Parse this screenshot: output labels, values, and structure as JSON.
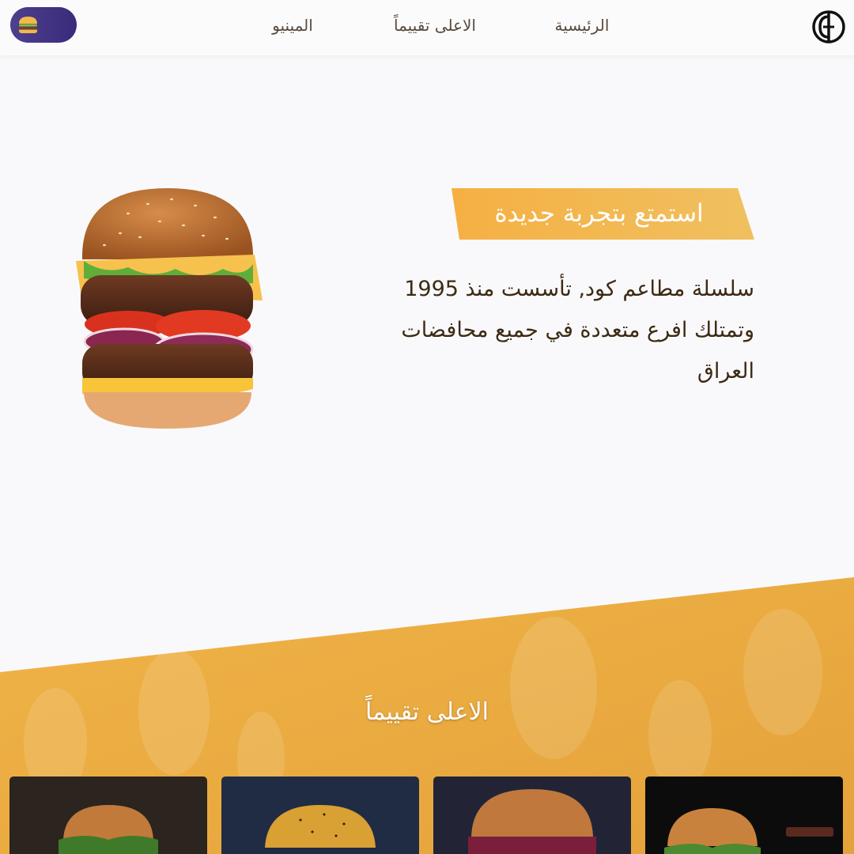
{
  "nav": {
    "links": [
      "الرئيسية",
      "الاعلى تقييماً",
      "المينيو"
    ]
  },
  "hero": {
    "banner": "استمتع بتجربة جديدة",
    "description": "سلسلة مطاعم كود, تأسست منذ 1995 وتمتلك افرع متعددة في جميع محافضات العراق"
  },
  "top_rated": {
    "title": "الاعلى تقييماً"
  },
  "colors": {
    "accent": "#f0a830",
    "toggle": "#3f2f80",
    "text": "#3c2a14"
  },
  "icons": [
    "logo-icon",
    "burger-toggle-icon"
  ]
}
